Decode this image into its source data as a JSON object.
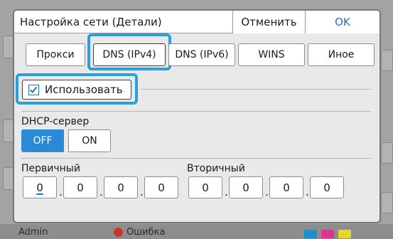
{
  "background": {
    "user_label": "Admin",
    "error_label": "Ошибка",
    "toner_colors": [
      "#1c8fd0",
      "#e0338d",
      "#e9d52a"
    ]
  },
  "dialog": {
    "title": "Настройка сети (Детали)",
    "cancel_label": "Отменить",
    "ok_label": "OK",
    "tabs": [
      {
        "label": "Прокси",
        "selected": false
      },
      {
        "label": "DNS (IPv4)",
        "selected": true
      },
      {
        "label": "DNS (IPv6)",
        "selected": false
      },
      {
        "label": "WINS",
        "selected": false
      },
      {
        "label": "Иное",
        "selected": false
      }
    ],
    "use_label": "Использовать",
    "use_checked": true,
    "dhcp_label": "DHCP-сервер",
    "dhcp_options": [
      {
        "label": "OFF",
        "selected": true
      },
      {
        "label": "ON",
        "selected": false
      }
    ],
    "primary": {
      "label": "Первичный",
      "octets": [
        "0",
        "0",
        "0",
        "0"
      ],
      "separator": "."
    },
    "secondary": {
      "label": "Вторичный",
      "octets": [
        "0",
        "0",
        "0",
        "0"
      ],
      "separator": "."
    }
  },
  "colors": {
    "accent": "#1e74c8",
    "focus": "#2b9fd9",
    "selected_fill": "#2b8ad8"
  }
}
